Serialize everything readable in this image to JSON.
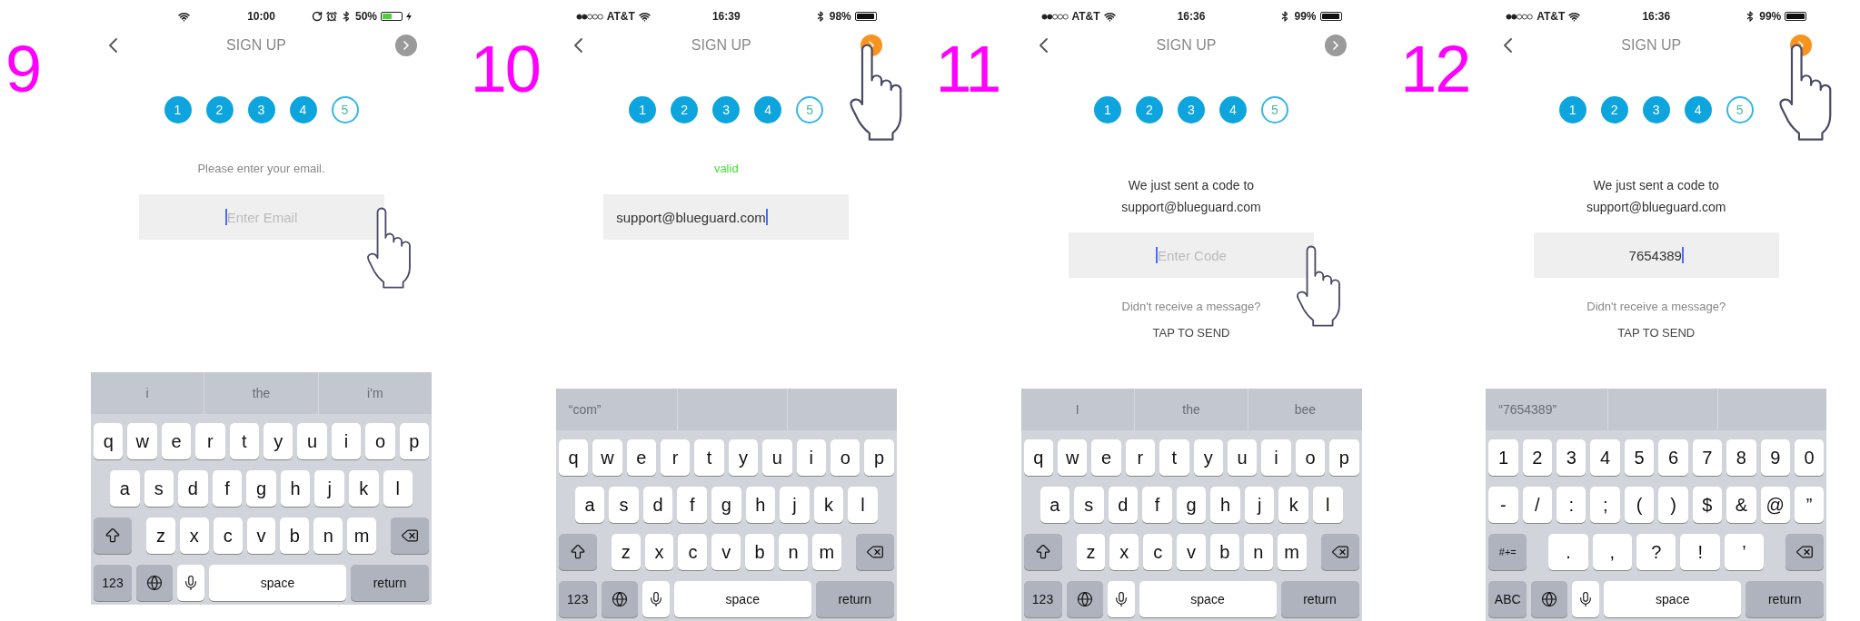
{
  "panels": [
    {
      "step": "9",
      "status": {
        "time": "10:00",
        "battery": "50%",
        "charging": true,
        "lock_and_alarm": true
      },
      "nav": {
        "title": "SIGN UP",
        "next_active": false,
        "next_touched": false
      },
      "steps": [
        {
          "label": "1",
          "completed": true
        },
        {
          "label": "2",
          "completed": true
        },
        {
          "label": "3",
          "completed": true
        },
        {
          "label": "4",
          "completed": true
        },
        {
          "label": "5",
          "completed": false
        }
      ],
      "message": {
        "kind": "prompt",
        "lines": [
          "Please enter your email."
        ]
      },
      "field": {
        "kind": "email",
        "placeholder": "Enter Email",
        "touched": true
      },
      "keyboard": {
        "kind": "letters",
        "suggestions": [
          "i",
          "the",
          "i'm"
        ],
        "rows": [
          [
            "q",
            "w",
            "e",
            "r",
            "t",
            "y",
            "u",
            "i",
            "o",
            "p"
          ],
          [
            "a",
            "s",
            "d",
            "f",
            "g",
            "h",
            "j",
            "k",
            "l"
          ]
        ],
        "third_row": [
          "z",
          "x",
          "c",
          "v",
          "b",
          "n",
          "m"
        ],
        "mode_key": "123",
        "space_key": "space",
        "return_key": "return"
      }
    },
    {
      "step": "10",
      "status": {
        "carrier": "AT&T",
        "time": "16:39",
        "battery": "98%",
        "charging": false,
        "lock_and_alarm": false
      },
      "nav": {
        "title": "SIGN UP",
        "next_active": true,
        "next_touched": true
      },
      "steps": [
        {
          "label": "1",
          "completed": true
        },
        {
          "label": "2",
          "completed": true
        },
        {
          "label": "3",
          "completed": true
        },
        {
          "label": "4",
          "completed": true
        },
        {
          "label": "5",
          "completed": false
        }
      ],
      "message": {
        "kind": "valid",
        "lines": [
          "valid"
        ]
      },
      "field": {
        "kind": "email",
        "value": "support@blueguard.com",
        "touched": false
      },
      "keyboard": {
        "kind": "letters",
        "suggestions": [
          "“com”"
        ],
        "rows": [
          [
            "q",
            "w",
            "e",
            "r",
            "t",
            "y",
            "u",
            "i",
            "o",
            "p"
          ],
          [
            "a",
            "s",
            "d",
            "f",
            "g",
            "h",
            "j",
            "k",
            "l"
          ]
        ],
        "third_row": [
          "z",
          "x",
          "c",
          "v",
          "b",
          "n",
          "m"
        ],
        "mode_key": "123",
        "space_key": "space",
        "return_key": "return"
      }
    },
    {
      "step": "11",
      "status": {
        "carrier": "AT&T",
        "time": "16:36",
        "battery": "99%",
        "charging": false,
        "lock_and_alarm": false
      },
      "nav": {
        "title": "SIGN UP",
        "next_active": false,
        "next_touched": false
      },
      "steps": [
        {
          "label": "1",
          "completed": true
        },
        {
          "label": "2",
          "completed": true
        },
        {
          "label": "3",
          "completed": true
        },
        {
          "label": "4",
          "completed": true
        },
        {
          "label": "5",
          "completed": false
        }
      ],
      "message": {
        "kind": "info",
        "lines": [
          "We just sent a code to",
          "support@blueguard.com"
        ]
      },
      "field": {
        "kind": "code",
        "placeholder": "Enter Code",
        "touched": true
      },
      "resend": {
        "question": "Didn't receive a message?",
        "action": "TAP TO SEND"
      },
      "keyboard": {
        "kind": "letters",
        "suggestions": [
          "I",
          "the",
          "bee"
        ],
        "rows": [
          [
            "q",
            "w",
            "e",
            "r",
            "t",
            "y",
            "u",
            "i",
            "o",
            "p"
          ],
          [
            "a",
            "s",
            "d",
            "f",
            "g",
            "h",
            "j",
            "k",
            "l"
          ]
        ],
        "third_row": [
          "z",
          "x",
          "c",
          "v",
          "b",
          "n",
          "m"
        ],
        "mode_key": "123",
        "space_key": "space",
        "return_key": "return"
      }
    },
    {
      "step": "12",
      "status": {
        "carrier": "AT&T",
        "time": "16:36",
        "battery": "99%",
        "charging": false,
        "lock_and_alarm": false
      },
      "nav": {
        "title": "SIGN UP",
        "next_active": true,
        "next_touched": true
      },
      "steps": [
        {
          "label": "1",
          "completed": true
        },
        {
          "label": "2",
          "completed": true
        },
        {
          "label": "3",
          "completed": true
        },
        {
          "label": "4",
          "completed": true
        },
        {
          "label": "5",
          "completed": false
        }
      ],
      "message": {
        "kind": "info",
        "lines": [
          "We just sent a code to",
          "support@blueguard.com"
        ]
      },
      "field": {
        "kind": "code",
        "value": "7654389",
        "touched": false
      },
      "resend": {
        "question": "Didn't receive a message?",
        "action": "TAP TO SEND"
      },
      "keyboard": {
        "kind": "numbers",
        "suggestions": [
          "“7654389”"
        ],
        "rows": [
          [
            "1",
            "2",
            "3",
            "4",
            "5",
            "6",
            "7",
            "8",
            "9",
            "0"
          ],
          [
            "-",
            "/",
            ":",
            ";",
            "(",
            ")",
            "$",
            "&",
            "@",
            "”"
          ]
        ],
        "third_row": [
          ".",
          ",",
          "?",
          "!",
          "’"
        ],
        "symbol_key": "#+=",
        "mode_key": "ABC",
        "space_key": "space",
        "return_key": "return"
      }
    }
  ]
}
